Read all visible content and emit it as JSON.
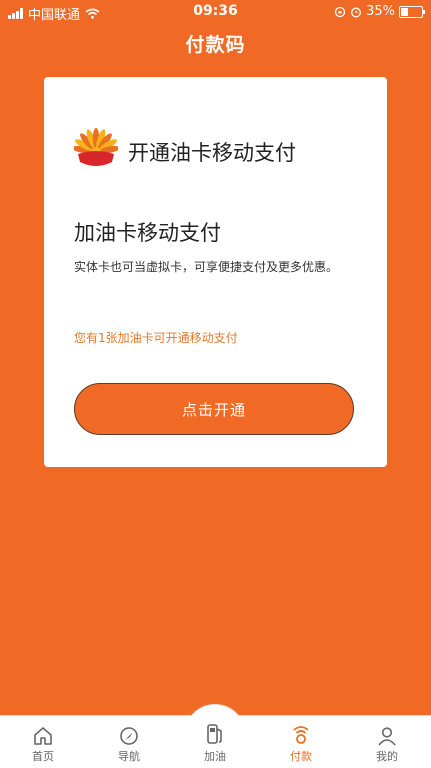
{
  "status_bar": {
    "carrier": "中国联通",
    "time": "09:36",
    "battery": "35%",
    "battery_level": 0.35
  },
  "header": {
    "title": "付款码"
  },
  "card": {
    "brand_title": "开通油卡移动支付",
    "heading": "加油卡移动支付",
    "description": "实体卡也可当虚拟卡，可享便捷支付及更多优惠。",
    "notice": "您有1张加油卡可开通移动支付",
    "button_label": "点击开通"
  },
  "tabs": [
    {
      "label": "首页",
      "icon": "home-icon"
    },
    {
      "label": "导航",
      "icon": "navigation-icon"
    },
    {
      "label": "加油",
      "icon": "fuel-pump-icon"
    },
    {
      "label": "付款",
      "icon": "payment-icon",
      "active": true
    },
    {
      "label": "我的",
      "icon": "user-icon"
    }
  ],
  "colors": {
    "brand_orange": "#F06A25",
    "logo_red": "#D9262C",
    "logo_yellow": "#F5B21B"
  }
}
